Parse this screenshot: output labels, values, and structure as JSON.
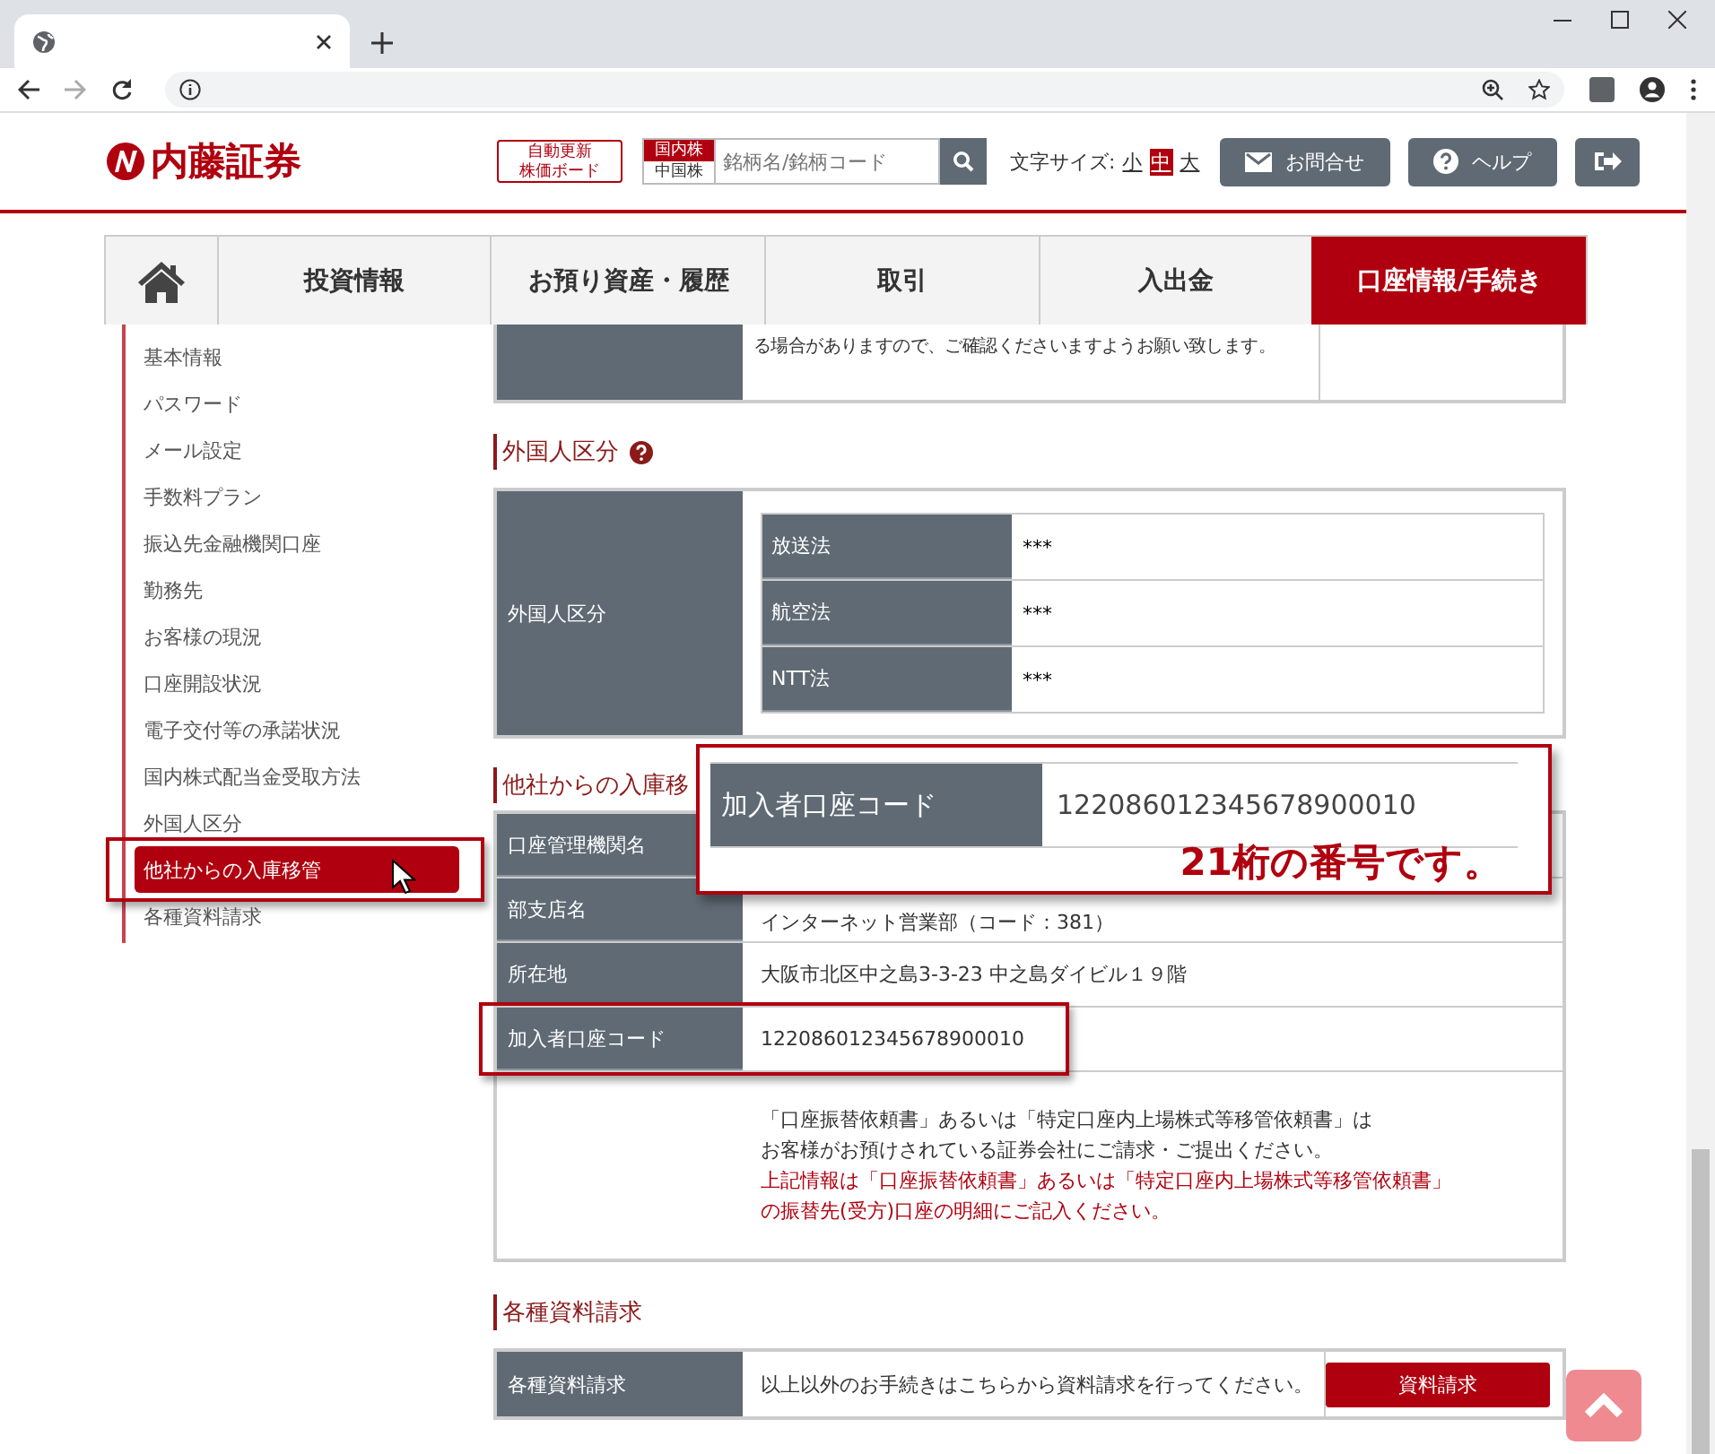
{
  "header": {
    "logo": "内藤証券",
    "auto_board": [
      "自動更新",
      "株価ボード"
    ],
    "market_tabs": [
      {
        "label": "国内株",
        "selected": true
      },
      {
        "label": "中国株",
        "selected": false
      }
    ],
    "search": {
      "placeholder": "銘柄名/銘柄コード"
    },
    "font_size": {
      "label": "文字サイズ:",
      "options": [
        {
          "label": "小",
          "selected": false
        },
        {
          "label": "中",
          "selected": true
        },
        {
          "label": "大",
          "selected": false
        }
      ]
    },
    "buttons": [
      {
        "kind": "mail",
        "label": "お問合せ"
      },
      {
        "kind": "help",
        "label": "ヘルプ"
      },
      {
        "kind": "logout"
      }
    ]
  },
  "nav": [
    {
      "kind": "home",
      "selected": false
    },
    {
      "kind": "text",
      "label": "投資情報",
      "selected": false
    },
    {
      "kind": "text",
      "label": "お預り資産・履歴",
      "selected": false
    },
    {
      "kind": "text",
      "label": "取引",
      "selected": false
    },
    {
      "kind": "text",
      "label": "入出金",
      "selected": false
    },
    {
      "kind": "text",
      "label": "口座情報/手続き",
      "selected": true
    }
  ],
  "sidebar": [
    {
      "label": "基本情報",
      "selected": false
    },
    {
      "label": "パスワード",
      "selected": false
    },
    {
      "label": "メール設定",
      "selected": false
    },
    {
      "label": "手数料プラン",
      "selected": false
    },
    {
      "label": "振込先金融機関口座",
      "selected": false
    },
    {
      "label": "勤務先",
      "selected": false
    },
    {
      "label": "お客様の現況",
      "selected": false
    },
    {
      "label": "口座開設状況",
      "selected": false
    },
    {
      "label": "電子交付等の承諾状況",
      "selected": false
    },
    {
      "label": "国内株式配当金受取方法",
      "selected": false
    },
    {
      "label": "外国人区分",
      "selected": false
    },
    {
      "label": "他社からの入庫移管",
      "selected": true
    },
    {
      "label": "各種資料請求",
      "selected": false
    }
  ],
  "top_table": {
    "text": "る場合がありますので、ご確認くださいますようお願い致します。"
  },
  "foreigner": {
    "title": "外国人区分",
    "label": "外国人区分",
    "rows": [
      {
        "label": "放送法",
        "value": "***"
      },
      {
        "label": "航空法",
        "value": "***"
      },
      {
        "label": "NTT法",
        "value": "***"
      }
    ]
  },
  "transfer": {
    "title": "他社からの入庫移",
    "rows": [
      {
        "label": "口座管理機関名",
        "highlighted": false
      },
      {
        "label": "部支店名",
        "value": "インターネット営業部（コード：381）",
        "highlighted": false
      },
      {
        "label": "所在地",
        "value": "大阪市北区中之島3-3-23 中之島ダイビル１９階",
        "highlighted": false
      },
      {
        "label": "加入者口座コード",
        "value": "122086012345678900010",
        "highlighted": true
      }
    ],
    "notes": [
      {
        "kind": "normal",
        "lines": [
          "「口座振替依頼書」あるいは「特定口座内上場株式等移管依頼書」は",
          "お客様がお預けされている証券会社にご請求・ご提出ください。"
        ]
      },
      {
        "kind": "warning",
        "lines": [
          "上記情報は「口座振替依頼書」あるいは「特定口座内上場株式等移管依頼書」",
          "の振替先(受方)口座の明細にご記入ください。"
        ]
      }
    ]
  },
  "callout": {
    "label": "加入者口座コード",
    "value": "122086012345678900010",
    "note": "21桁の番号です。"
  },
  "documents": {
    "title": "各種資料請求",
    "label": "各種資料請求",
    "text": "以上以外のお手続きはこちらから資料請求を行ってください。",
    "button": "資料請求"
  }
}
